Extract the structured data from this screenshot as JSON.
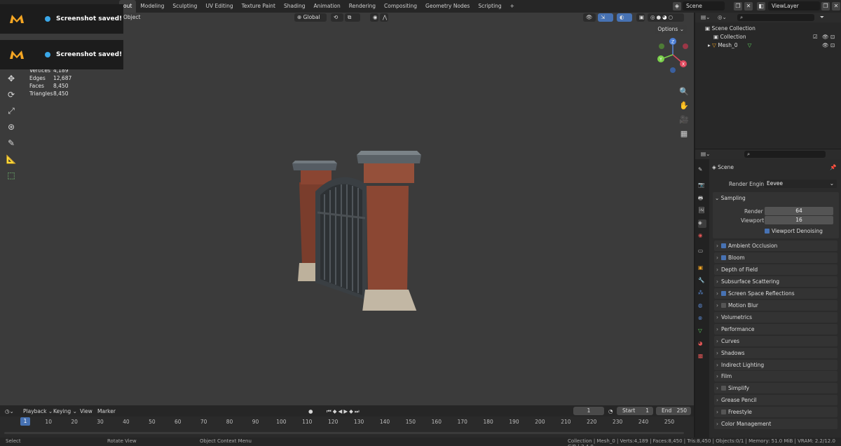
{
  "topbar": {
    "workspaces": [
      "out",
      "Modeling",
      "Sculpting",
      "UV Editing",
      "Texture Paint",
      "Shading",
      "Animation",
      "Rendering",
      "Compositing",
      "Geometry Nodes",
      "Scripting"
    ],
    "add_tab": "+",
    "scene": "Scene",
    "view_layer": "ViewLayer"
  },
  "viewport": {
    "mode": "Object",
    "orientation": "Global",
    "options": "Options",
    "stats": [
      {
        "k": "Vertices",
        "v": "4,189"
      },
      {
        "k": "Edges",
        "v": "12,687"
      },
      {
        "k": "Faces",
        "v": "8,450"
      },
      {
        "k": "Triangles",
        "v": "8,450"
      }
    ],
    "gizmo": {
      "x": "X",
      "y": "Y",
      "z": "Z"
    }
  },
  "toasts": [
    {
      "msg": "Screenshot saved!"
    },
    {
      "msg": "Screenshot saved!"
    }
  ],
  "timeline": {
    "menus": [
      "Playback",
      "Keying",
      "View",
      "Marker"
    ],
    "current_frame": "1",
    "start_label": "Start",
    "start": "1",
    "end_label": "End",
    "end": "250",
    "ticks": [
      "1",
      "10",
      "20",
      "30",
      "40",
      "50",
      "60",
      "70",
      "80",
      "90",
      "100",
      "110",
      "120",
      "130",
      "140",
      "150",
      "160",
      "170",
      "180",
      "190",
      "200",
      "210",
      "220",
      "230",
      "240",
      "250"
    ]
  },
  "status": {
    "select": "Select",
    "rotate": "Rotate View",
    "context": "Object Context Menu",
    "info": "Collection | Mesh_0 | Verts:4,189 | Faces:8,450 | Tris:8,450 | Objects:0/1 | Memory: 51.0 MiB | VRAM: 2.2/12.0 GiB | 3.4.0"
  },
  "outliner": {
    "scene_collection": "Scene Collection",
    "collection": "Collection",
    "mesh": "Mesh_0"
  },
  "properties": {
    "context": "Scene",
    "render_engine_label": "Render Engine",
    "render_engine": "Eevee",
    "sampling": "Sampling",
    "render_label": "Render",
    "render_value": "64",
    "viewport_label": "Viewport",
    "viewport_value": "16",
    "viewport_denoising": "Viewport Denoising",
    "sections": [
      {
        "label": "Ambient Occlusion",
        "checkbox": true
      },
      {
        "label": "Bloom",
        "checkbox": true
      },
      {
        "label": "Depth of Field",
        "checkbox": null
      },
      {
        "label": "Subsurface Scattering",
        "checkbox": null
      },
      {
        "label": "Screen Space Reflections",
        "checkbox": true
      },
      {
        "label": "Motion Blur",
        "checkbox": false
      },
      {
        "label": "Volumetrics",
        "checkbox": null
      },
      {
        "label": "Performance",
        "checkbox": null
      },
      {
        "label": "Curves",
        "checkbox": null
      },
      {
        "label": "Shadows",
        "checkbox": null
      },
      {
        "label": "Indirect Lighting",
        "checkbox": null
      },
      {
        "label": "Film",
        "checkbox": null
      },
      {
        "label": "Simplify",
        "checkbox": false
      },
      {
        "label": "Grease Pencil",
        "checkbox": null
      },
      {
        "label": "Freestyle",
        "checkbox": false
      },
      {
        "label": "Color Management",
        "checkbox": null
      }
    ]
  },
  "colors": {
    "accent": "#4772b3",
    "viewport_bg": "#3b3b3b",
    "logo": "#f5a623"
  }
}
